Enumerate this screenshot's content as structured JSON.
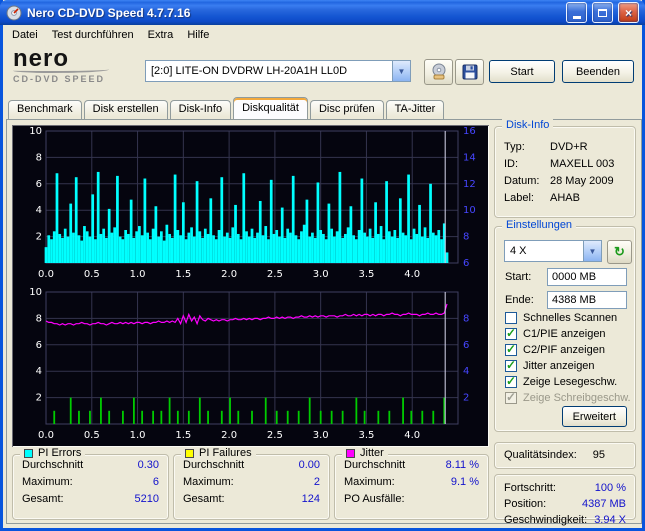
{
  "window": {
    "title": "Nero CD-DVD Speed 4.7.7.16"
  },
  "menu": {
    "items": [
      "Datei",
      "Test durchführen",
      "Extra",
      "Hilfe"
    ]
  },
  "brand": {
    "name": "nero",
    "product": "CD-DVD SPEED"
  },
  "toolbar": {
    "drive": "[2:0]   LITE-ON DVDRW LH-20A1H LL0D",
    "start_label": "Start",
    "quit_label": "Beenden"
  },
  "tabs": [
    {
      "label": "Benchmark"
    },
    {
      "label": "Disk erstellen"
    },
    {
      "label": "Disk-Info"
    },
    {
      "label": "Diskqualität",
      "active": true
    },
    {
      "label": "Disc prüfen"
    },
    {
      "label": "TA-Jitter"
    }
  ],
  "disk_info": {
    "title": "Disk-Info",
    "rows": [
      {
        "label": "Typ:",
        "value": "DVD+R"
      },
      {
        "label": "ID:",
        "value": "MAXELL 003"
      },
      {
        "label": "Datum:",
        "value": "28 May 2009"
      },
      {
        "label": "Label:",
        "value": "AHAB"
      }
    ]
  },
  "settings": {
    "title": "Einstellungen",
    "speed": "4 X",
    "start_label": "Start:",
    "start_value": "0000 MB",
    "end_label": "Ende:",
    "end_value": "4388 MB",
    "checkboxes": [
      {
        "label": "Schnelles Scannen",
        "mark": ""
      },
      {
        "label": "C1/PIE anzeigen",
        "mark": "✓"
      },
      {
        "label": "C2/PIF anzeigen",
        "mark": "✓"
      },
      {
        "label": "Jitter anzeigen",
        "mark": "✓"
      },
      {
        "label": "Zeige Lesegeschw.",
        "mark": "✓"
      },
      {
        "label": "Zeige Schreibgeschw.",
        "mark": "✓",
        "disabled": true
      }
    ],
    "advanced_label": "Erweitert"
  },
  "quality": {
    "label": "Qualitätsindex:",
    "value": "95"
  },
  "progress": {
    "rows": [
      {
        "label": "Fortschritt:",
        "value": "100 %"
      },
      {
        "label": "Position:",
        "value": "4387 MB"
      },
      {
        "label": "Geschwindigkeit:",
        "value": "3.94 X"
      }
    ]
  },
  "stats": [
    {
      "title": "PI Errors",
      "swatch": "#00ffff",
      "rows": [
        {
          "label": "Durchschnitt",
          "value": "0.30"
        },
        {
          "label": "Maximum:",
          "value": "6"
        },
        {
          "label": "Gesamt:",
          "value": "5210"
        }
      ]
    },
    {
      "title": "PI Failures",
      "swatch": "#ffff00",
      "rows": [
        {
          "label": "Durchschnitt",
          "value": "0.00"
        },
        {
          "label": "Maximum:",
          "value": "2"
        },
        {
          "label": "Gesamt:",
          "value": "124"
        }
      ]
    },
    {
      "title": "Jitter",
      "swatch": "#ff00ff",
      "rows": [
        {
          "label": "Durchschnitt",
          "value": "8.11 %"
        },
        {
          "label": "Maximum:",
          "value": "9.1 %"
        },
        {
          "label": "PO Ausfälle:",
          "value": ""
        }
      ]
    }
  ],
  "colors": {
    "chart_bg": "#05050f",
    "grid": "#34344e",
    "axis_text": "#ffffff",
    "right_axis_text": "#4646ff",
    "cursor": "#d9d9ef",
    "pie": "#00ffff",
    "pif": "#00cc00",
    "jitter": "#ff00ff",
    "value_text": "#1212cc",
    "group_title": "#0046d5"
  },
  "chart_data": [
    {
      "type": "bar",
      "name": "PI Errors (PIE) vs position (GB)",
      "xlim": [
        0,
        4.5
      ],
      "ylim": [
        0,
        10
      ],
      "x_ticks": [
        0,
        0.5,
        1,
        1.5,
        2,
        2.5,
        3,
        3.5,
        4
      ],
      "y_ticks_left": [
        2,
        4,
        6,
        8,
        10
      ],
      "y_ticks_right": {
        "values": [
          6,
          8,
          10,
          12,
          14,
          16
        ],
        "at": [
          0,
          2,
          4,
          6,
          8,
          10
        ]
      },
      "x_end": 4.38,
      "cursor_x": 4.36,
      "bar_color": "#00ffff",
      "values": [
        1.2,
        2.1,
        1.8,
        2.4,
        6.8,
        2.2,
        1.9,
        2.6,
        2.0,
        4.5,
        2.3,
        6.5,
        2.1,
        1.7,
        2.8,
        2.4,
        2.0,
        5.2,
        1.8,
        6.9,
        2.2,
        2.6,
        1.9,
        4.1,
        2.3,
        2.7,
        6.6,
        2.0,
        1.8,
        2.5,
        2.2,
        4.8,
        1.9,
        2.4,
        2.8,
        2.1,
        6.4,
        2.3,
        1.8,
        2.6,
        4.3,
        2.0,
        2.4,
        1.7,
        2.9,
        2.2,
        1.9,
        6.7,
        2.5,
        2.1,
        4.6,
        1.8,
        2.3,
        2.7,
        2.0,
        6.2,
        2.4,
        1.9,
        2.6,
        2.2,
        4.9,
        2.1,
        1.8,
        2.5,
        6.5,
        2.0,
        2.3,
        1.9,
        2.7,
        4.4,
        2.2,
        1.8,
        6.8,
        2.4,
        2.0,
        2.6,
        1.9,
        2.3,
        4.7,
        2.1,
        2.8,
        1.8,
        6.3,
        2.2,
        2.5,
        2.0,
        4.2,
        1.9,
        2.6,
        2.3,
        6.6,
        2.1,
        1.8,
        2.4,
        2.9,
        4.8,
        2.0,
        2.3,
        1.9,
        6.1,
        2.5,
        2.2,
        1.8,
        4.5,
        2.6,
        2.0,
        2.4,
        6.9,
        1.9,
        2.2,
        2.7,
        4.3,
        2.1,
        1.8,
        2.5,
        6.4,
        2.3,
        2.0,
        2.6,
        1.9,
        4.6,
        2.2,
        2.8,
        1.8,
        6.2,
        2.4,
        2.0,
        2.5,
        1.9,
        4.9,
        2.3,
        2.1,
        6.7,
        1.8,
        2.6,
        2.2,
        4.4,
        2.0,
        2.7,
        1.9,
        6.0,
        2.3,
        2.1,
        2.5,
        1.8,
        3.0,
        0.8
      ]
    },
    {
      "type": "composite",
      "name": "PI Failures (PIF) and Jitter vs position (GB)",
      "xlim": [
        0,
        4.5
      ],
      "ylim": [
        0,
        10
      ],
      "x_ticks": [
        0,
        0.5,
        1,
        1.5,
        2,
        2.5,
        3,
        3.5,
        4
      ],
      "y_ticks_left": [
        2,
        4,
        6,
        8,
        10
      ],
      "y_ticks_right": {
        "values": [
          2,
          4,
          6,
          8
        ],
        "at": [
          2,
          4,
          6,
          8
        ]
      },
      "x_end": 4.38,
      "cursor_x": 4.36,
      "series": [
        {
          "name": "PI Failures",
          "type": "bar",
          "color": "#00cc00",
          "bar_width": 1.8,
          "values": [
            0,
            0,
            0,
            1,
            0,
            0,
            0,
            0,
            0,
            2,
            0,
            0,
            1,
            0,
            0,
            0,
            1,
            0,
            0,
            0,
            2,
            0,
            0,
            1,
            0,
            0,
            0,
            0,
            1,
            0,
            0,
            0,
            2,
            0,
            0,
            1,
            0,
            0,
            0,
            1,
            0,
            0,
            1,
            0,
            0,
            2,
            0,
            0,
            1,
            0,
            0,
            0,
            1,
            0,
            0,
            0,
            2,
            0,
            0,
            1,
            0,
            0,
            0,
            0,
            1,
            0,
            0,
            2,
            0,
            0,
            1,
            0,
            0,
            0,
            0,
            1,
            0,
            0,
            0,
            0,
            2,
            0,
            0,
            0,
            1,
            0,
            0,
            0,
            1,
            0,
            0,
            0,
            1,
            0,
            0,
            0,
            2,
            0,
            0,
            0,
            1,
            0,
            0,
            0,
            1,
            0,
            0,
            0,
            1,
            0,
            0,
            0,
            0,
            2,
            0,
            0,
            1,
            0,
            0,
            0,
            0,
            1,
            0,
            0,
            0,
            1,
            0,
            0,
            0,
            0,
            2,
            0,
            0,
            1,
            0,
            0,
            0,
            1,
            0,
            0,
            0,
            1,
            0,
            0,
            0,
            2,
            0
          ]
        },
        {
          "name": "Jitter (%)",
          "type": "line",
          "color": "#ff00ff",
          "values": [
            7.8,
            7.7,
            7.7,
            7.6,
            7.6,
            7.5,
            7.6,
            7.5,
            7.6,
            7.6,
            7.5,
            7.6,
            7.6,
            7.7,
            7.6,
            7.6,
            7.5,
            7.6,
            7.6,
            7.7,
            7.6,
            7.6,
            7.5,
            7.6,
            7.7,
            7.6,
            7.6,
            7.7,
            7.6,
            7.7,
            7.6,
            7.7,
            7.6,
            7.7,
            7.7,
            7.6,
            7.7,
            7.7,
            7.6,
            7.7,
            7.7,
            7.8,
            7.7,
            7.7,
            7.8,
            7.7,
            7.8,
            7.7,
            8.0,
            7.6,
            8.2,
            7.7,
            8.3,
            7.8,
            8.1,
            7.6,
            8.2,
            7.9,
            7.8,
            8.0,
            7.9,
            7.8,
            7.9,
            7.8,
            7.9,
            7.9,
            7.8,
            7.9,
            7.9,
            8.0,
            7.9,
            7.9,
            8.0,
            7.9,
            8.0,
            7.9,
            8.0,
            8.0,
            7.9,
            8.0,
            8.0,
            8.1,
            8.0,
            8.0,
            8.1,
            8.0,
            8.1,
            8.0,
            8.1,
            8.1,
            8.0,
            8.1,
            8.1,
            8.2,
            8.1,
            8.1,
            8.2,
            8.1,
            8.2,
            8.1,
            8.2,
            8.2,
            8.1,
            8.2,
            8.2,
            8.2,
            8.1,
            8.2,
            8.2,
            8.3,
            8.2,
            8.2,
            8.3,
            8.2,
            8.3,
            8.2,
            8.3,
            8.3,
            8.2,
            8.3,
            8.2,
            8.3,
            8.3,
            8.2,
            8.3,
            8.3,
            8.4,
            8.3,
            8.3,
            8.2,
            8.3,
            8.3,
            8.4,
            8.3,
            8.3,
            8.3,
            8.2,
            8.3,
            8.3,
            8.4,
            8.3,
            8.3,
            8.4,
            8.3,
            8.3,
            8.4,
            9.1
          ]
        }
      ]
    }
  ]
}
